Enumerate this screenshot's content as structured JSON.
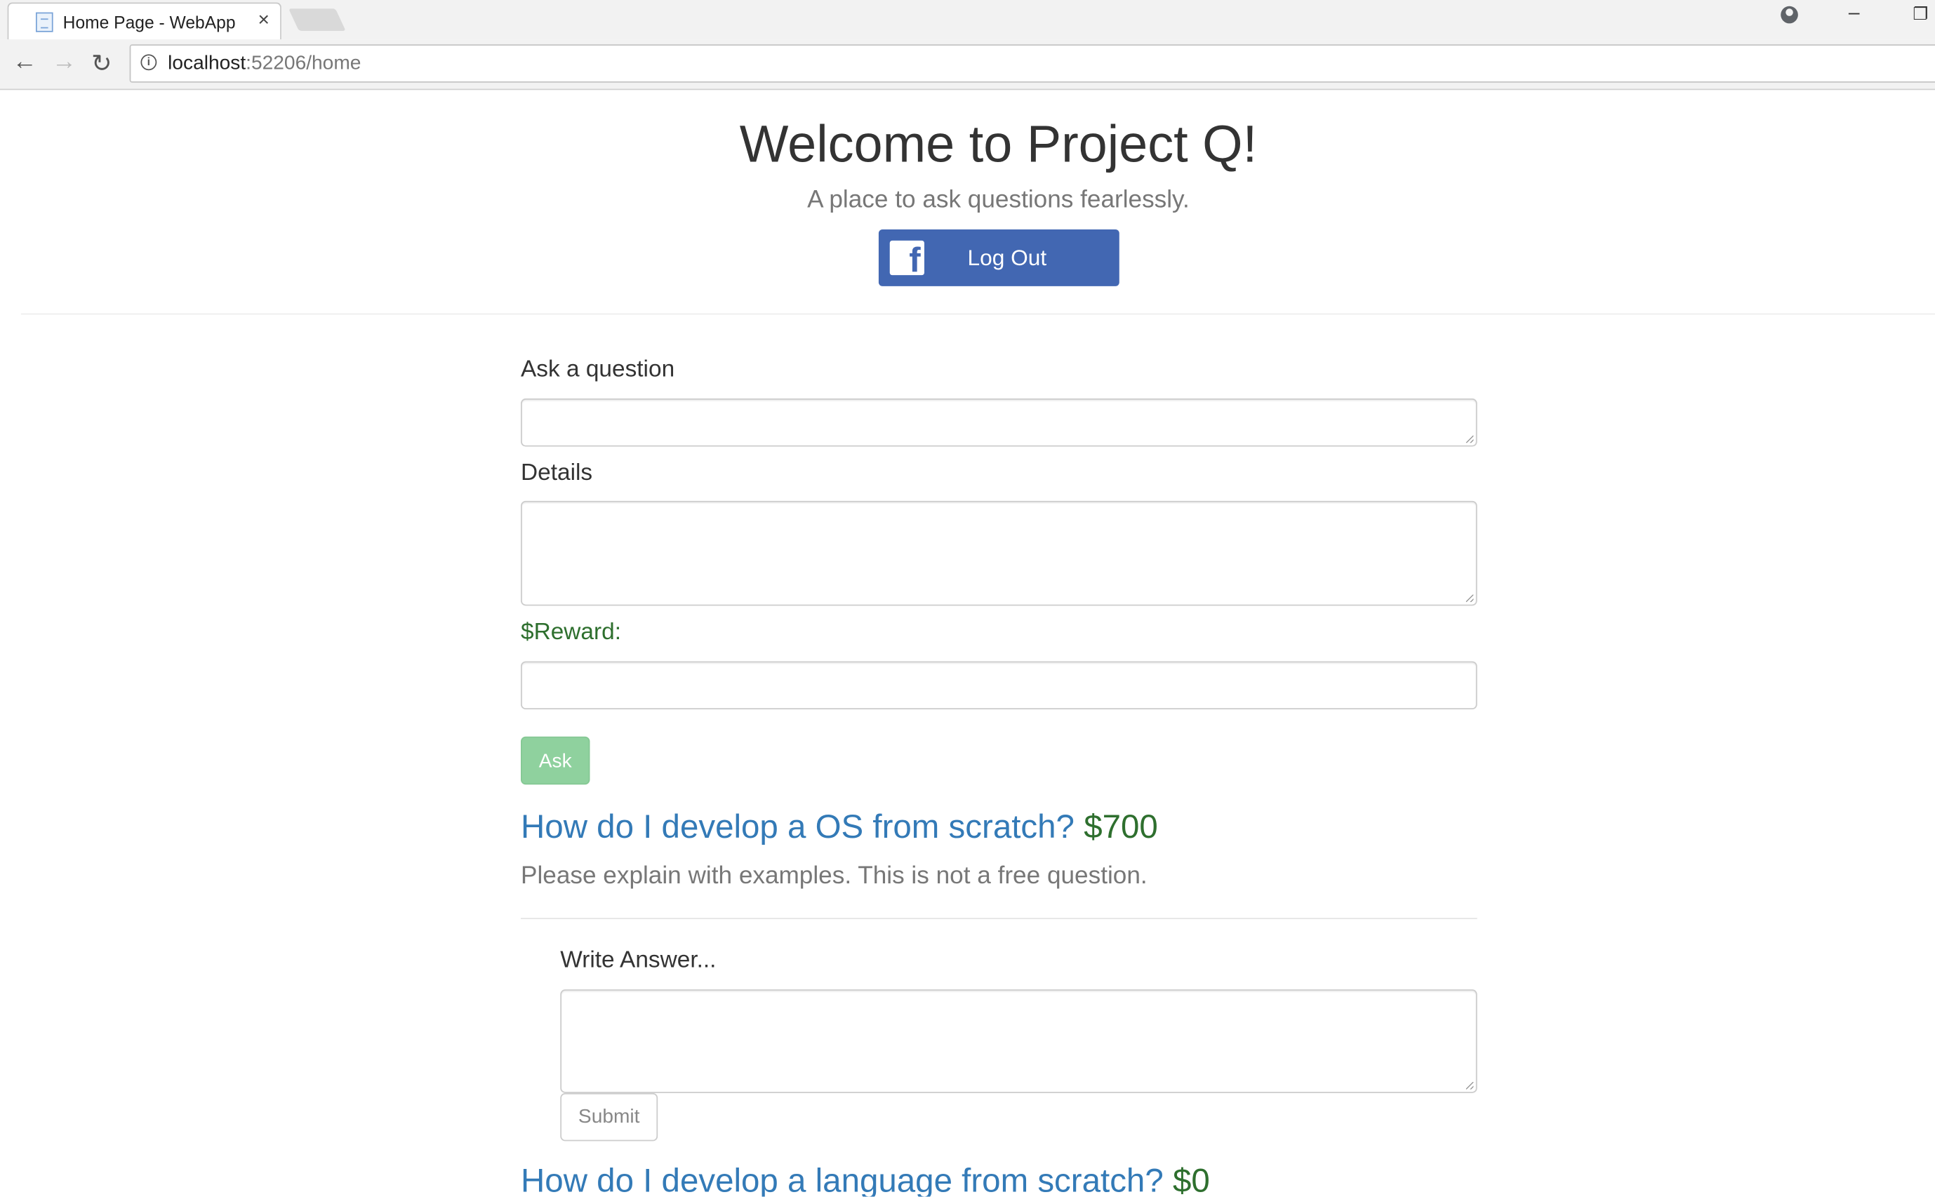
{
  "browser": {
    "tab_title": "Home Page - WebApp",
    "tab_close": "×",
    "url_host": "localhost",
    "url_rest": ":52206/home",
    "icons": [
      "back-arrow-icon",
      "forward-arrow-icon",
      "reload-icon",
      "info-icon",
      "profile-icon",
      "minimize-icon",
      "restore-icon",
      "close-icon",
      "page-favicon"
    ]
  },
  "header": {
    "title": "Welcome to Project Q!",
    "subtitle": "A place to ask questions fearlessly.",
    "logout_label": "Log Out",
    "fb_letter": "f",
    "brand_color": "#4267b2"
  },
  "ask_form": {
    "question_label": "Ask a question",
    "question_value": "",
    "details_label": "Details",
    "details_value": "",
    "reward_label": "$Reward:",
    "reward_value": "",
    "ask_label": "Ask"
  },
  "questions": [
    {
      "title": "How do I develop a OS from scratch?",
      "reward": "$700",
      "details": "Please explain with examples. This is not a free question.",
      "answer_label": "Write Answer...",
      "answer_value": "",
      "submit_label": "Submit"
    },
    {
      "title": "How do I develop a language from scratch?",
      "reward": "$0"
    }
  ],
  "colors": {
    "link": "#337ab7",
    "reward": "#2e6f2e",
    "ask_button": "#8fd19e"
  }
}
